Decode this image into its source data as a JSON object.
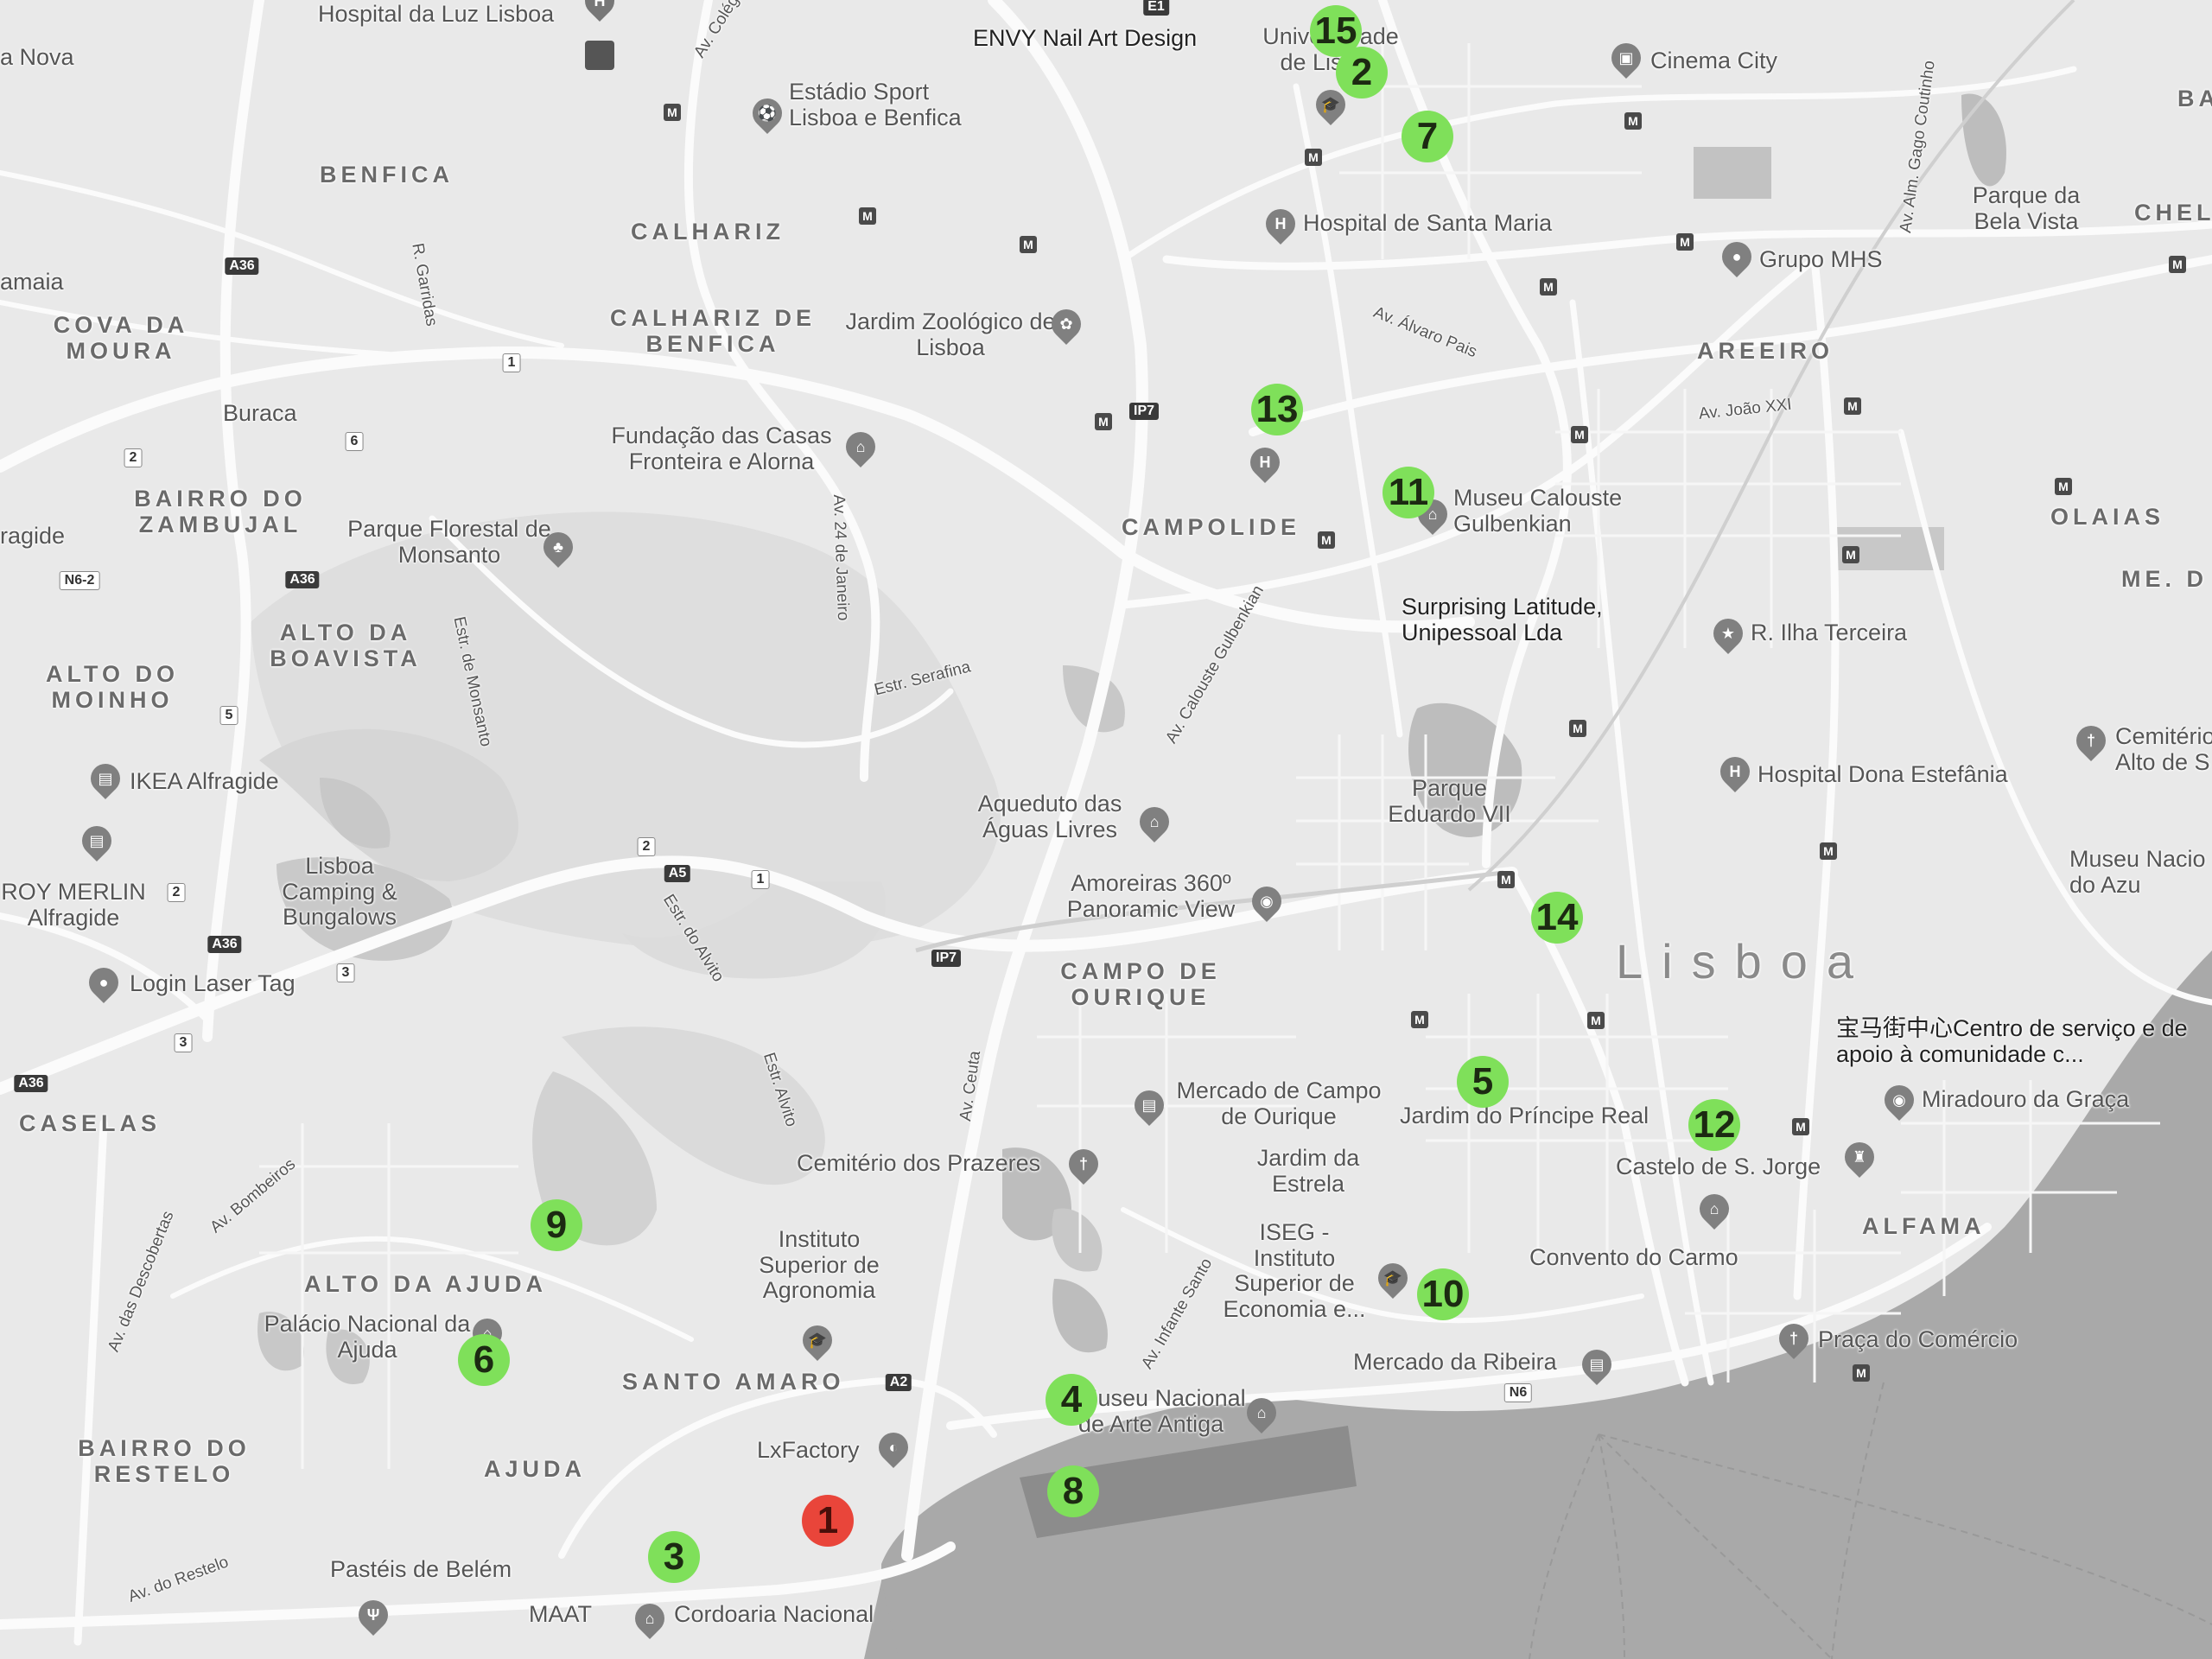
{
  "markers": {
    "start": "1",
    "numbered": [
      "2",
      "3",
      "4",
      "5",
      "6",
      "7",
      "8",
      "9",
      "10",
      "11",
      "12",
      "13",
      "14",
      "15"
    ]
  },
  "districts": {
    "benfica": "BENFICA",
    "calhariz": "CALHARIZ",
    "calhariz_benfica": "CALHARIZ DE BENFICA",
    "cova_da_moura": "COVA DA MOURA",
    "buraca": "Buraca",
    "bairro_zambujal": "BAIRRO DO ZAMBUJAL",
    "alto_boavista": "ALTO DA BOAVISTA",
    "alto_moinho": "ALTO DO MOINHO",
    "campolide": "CAMPOLIDE",
    "areeiro": "AREEIRO",
    "olaias": "OLAIAS",
    "campo_ourique": "CAMPO DE OURIQUE",
    "casselas": "CASELAS",
    "alto_ajuda": "ALTO DA AJUDA",
    "santo_amaro": "SANTO AMARO",
    "ajuda": "AJUDA",
    "bairro_restelo": "BAIRRO DO RESTELO",
    "alfama": "ALFAMA",
    "lisboa": "Lisboa",
    "edge_nova": "a Nova",
    "edge_amaia": "amaia",
    "edge_ragide": "ragide",
    "edge_chel": "CHEL",
    "edge_me_d": "ME. D",
    "edge_ba_am": "BA AM"
  },
  "places": {
    "hospital_luz": "Hospital da Luz Lisboa",
    "envy": "ENVY Nail Art Design",
    "universidade": "Universidade de Lisboa",
    "cinema_city": "Cinema City",
    "estadio": "Estádio Sport Lisboa e Benfica",
    "hospital_santa_maria": "Hospital de Santa Maria",
    "parque_bela_vista": "Parque da Bela Vista",
    "grupo_mhs": "Grupo MHS",
    "jardim_zoologico": "Jardim Zoológico de Lisboa",
    "fundacao": "Fundação das Casas Fronteira e Alorna",
    "parque_monsanto": "Parque Florestal de Monsanto",
    "museu_gulbenkian": "Museu Calouste Gulbenkian",
    "surprising": "Surprising Latitude, Unipessoal Lda",
    "ilha_terceira": "R. Ilha Terceira",
    "ikea": "IKEA Alfragide",
    "leroy": "ROY MERLIN Alfragide",
    "camping": "Lisboa Camping & Bungalows",
    "laser_tag": "Login Laser Tag",
    "parque_eduardo": "Parque Eduardo VII",
    "hospital_estefania": "Hospital Dona Estefânia",
    "cemiterio_alto": "Cemitério Alto de S",
    "museu_azu": "Museu Nacio do Azu",
    "aqueduto": "Aqueduto das Águas Livres",
    "amoreiras": "Amoreiras 360º Panoramic View",
    "chinese_center": "宝马街中心Centro de serviço e de apoio à comunidade c...",
    "mercado_ourique": "Mercado de Campo de Ourique",
    "principe_real": "Jardim do Príncipe Real",
    "miradouro": "Miradouro da Graça",
    "cemiterio_prazeres": "Cemitério dos Prazeres",
    "jardim_estrela": "Jardim da Estrela",
    "castelo": "Castelo de S. Jorge",
    "instituto_agronomia": "Instituto Superior de Agronomia",
    "iseg": "ISEG - Instituto Superior de Economia e...",
    "convento_carmo": "Convento do Carmo",
    "palacio_ajuda": "Palácio Nacional da Ajuda",
    "mercado_ribeira": "Mercado da Ribeira",
    "praca_comercio": "Praça do Comércio",
    "museu_arte_antiga": "Museu Nacional de Arte Antiga",
    "lxfactory": "LxFactory",
    "pasteis": "Pastéis de Belém",
    "maat": "MAAT",
    "cordoaria": "Cordoaria Nacional"
  },
  "roads": {
    "colegio_militar": "Av. Colégio Mi",
    "r_garridas": "R. Garridas",
    "alvaro_pais": "Av. Álvaro Pais",
    "joao_xxi": "Av. João XXI",
    "gago_coutinho": "Av. Alm. Gago Coutinho",
    "av_24_janeiro": "Av. 24 de Janeiro",
    "estr_serafina": "Estr. Serafina",
    "estr_monsanto": "Estr. de Monsanto",
    "calouste_gulbenkian": "Av. Calouste Gulbenkian",
    "estr_alvito": "Estr. do Alvito",
    "estr_alvito2": "Estr. Alvito",
    "av_ceuta": "Av. Ceuta",
    "av_bombeiros": "Av. Bombeiros",
    "av_descobertas": "Av. das Descobertas",
    "av_infante_santo": "Av. Infante Santo",
    "av_restelo": "Av. do Restelo"
  },
  "shields": {
    "a36_1": "A36",
    "a36_2": "A36",
    "a36_3": "A36",
    "a36_4": "A36",
    "n6_2": "N6-2",
    "a5": "A5",
    "ip7_1": "IP7",
    "ip7_2": "IP7",
    "a2": "A2",
    "n6": "N6",
    "e1": "E1",
    "n1": "1",
    "n2": "2",
    "n6b": "6",
    "n5": "5",
    "n2b": "2",
    "n2c": "2",
    "n1b": "1",
    "n3": "3",
    "n3b": "3"
  },
  "colors": {
    "background": "#e9e9e9",
    "water": "#a9a9a9",
    "green_marker": "#7fe05a",
    "red_marker": "#e9453a",
    "poi": "#808080"
  },
  "icons": [
    "hospital-icon",
    "metro-icon",
    "stadium-icon",
    "school-icon",
    "pin-icon",
    "tree-icon",
    "camera-icon",
    "shopping-icon",
    "museum-icon",
    "star-icon",
    "church-icon",
    "palette-icon",
    "cafe-icon"
  ]
}
